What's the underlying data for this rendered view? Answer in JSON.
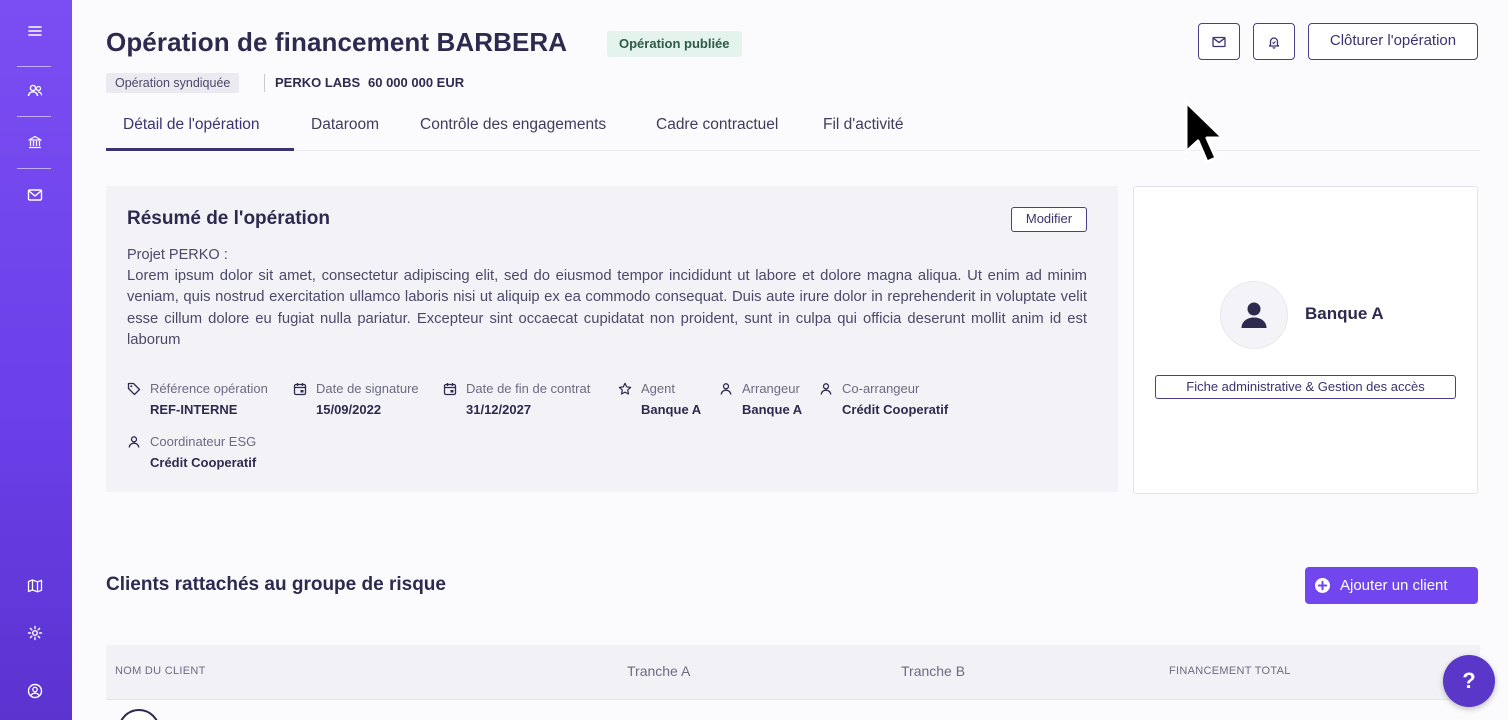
{
  "sidebar": {
    "top_icons": [
      "menu-icon",
      "users-icon",
      "bank-icon",
      "mail-icon"
    ],
    "bottom_icons": [
      "map-icon",
      "gear-icon",
      "account-icon"
    ]
  },
  "header": {
    "title": "Opération de financement BARBERA",
    "status_badge": "Opération publiée",
    "type_tag": "Opération syndiquée",
    "company": "PERKO LABS",
    "amount": "60 000 000 EUR",
    "close_button": "Clôturer l'opération"
  },
  "tabs": [
    {
      "label": "Détail de l'opération",
      "active": true
    },
    {
      "label": "Dataroom",
      "active": false
    },
    {
      "label": "Contrôle des engagements",
      "active": false
    },
    {
      "label": "Cadre contractuel",
      "active": false
    },
    {
      "label": "Fil d'activité",
      "active": false
    }
  ],
  "summary": {
    "title": "Résumé de l'opération",
    "modify_button": "Modifier",
    "project_label": "Projet PERKO :",
    "description": "Lorem ipsum dolor sit amet, consectetur adipiscing elit, sed do eiusmod tempor incididunt ut labore et dolore magna aliqua. Ut enim ad minim veniam, quis nostrud exercitation ullamco laboris nisi ut aliquip ex ea commodo consequat. Duis aute irure dolor in reprehenderit in voluptate velit esse cillum dolore eu fugiat nulla pariatur. Excepteur sint occaecat cupidatat non proident, sunt in culpa qui officia deserunt mollit anim id est laborum",
    "fields": [
      {
        "label": "Référence opération",
        "value": "REF-INTERNE",
        "icon": "tag-icon"
      },
      {
        "label": "Date de signature",
        "value": "15/09/2022",
        "icon": "calendar-icon"
      },
      {
        "label": "Date de fin de contrat",
        "value": "31/12/2027",
        "icon": "calendar-icon"
      },
      {
        "label": "Agent",
        "value": "Banque A",
        "icon": "star-icon"
      },
      {
        "label": "Arrangeur",
        "value": "Banque A",
        "icon": "person-icon"
      },
      {
        "label": "Co-arrangeur",
        "value": "Crédit Cooperatif",
        "icon": "person-icon"
      },
      {
        "label": "Coordinateur ESG",
        "value": "Crédit Cooperatif",
        "icon": "person-icon"
      }
    ]
  },
  "bank_card": {
    "name": "Banque A",
    "admin_button": "Fiche administrative & Gestion des accès"
  },
  "clients": {
    "title": "Clients rattachés au groupe de risque",
    "add_button": "Ajouter un client",
    "columns": [
      "NOM DU CLIENT",
      "Tranche A",
      "Tranche B",
      "FINANCEMENT TOTAL"
    ]
  },
  "help_button": "?",
  "colors": {
    "accent": "#7146ef",
    "sidebar": "#6a3fe8",
    "text_dark": "#2e2a4f",
    "badge_bg": "#e4f4ec"
  }
}
